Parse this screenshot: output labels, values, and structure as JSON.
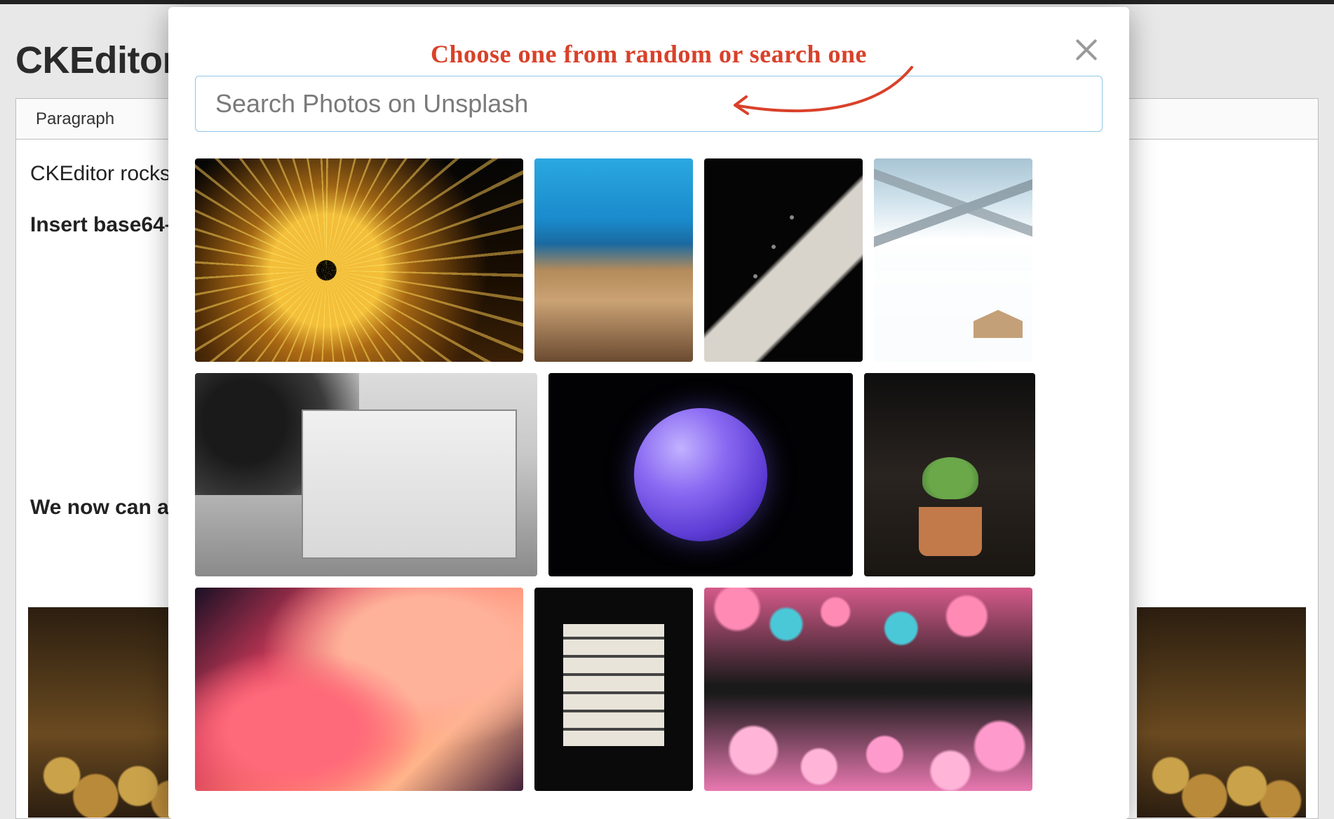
{
  "page": {
    "title_partial": "CKEditor D",
    "toolbar": {
      "paragraph_label": "Paragraph"
    },
    "body": {
      "line1_partial": "CKEditor rocks",
      "line2_partial": "Insert base64–",
      "line3_partial": "We now can ad"
    }
  },
  "modal": {
    "annotation": "Choose one from random or search one",
    "search_placeholder": "Search Photos on Unsplash",
    "thumbs": {
      "row1": [
        "sparks-steel-wool",
        "ocean-horizon-blur",
        "dark-edge-geometry",
        "snowy-mountains"
      ],
      "row2": [
        "bw-market-building",
        "neptune-planet",
        "succulent-pots"
      ],
      "row3": [
        "pink-fluid-swirl",
        "dark-room-window",
        "colorful-cells-pattern"
      ]
    }
  },
  "colors": {
    "annotation": "#d9412a",
    "search_border": "#8fc6e8"
  }
}
